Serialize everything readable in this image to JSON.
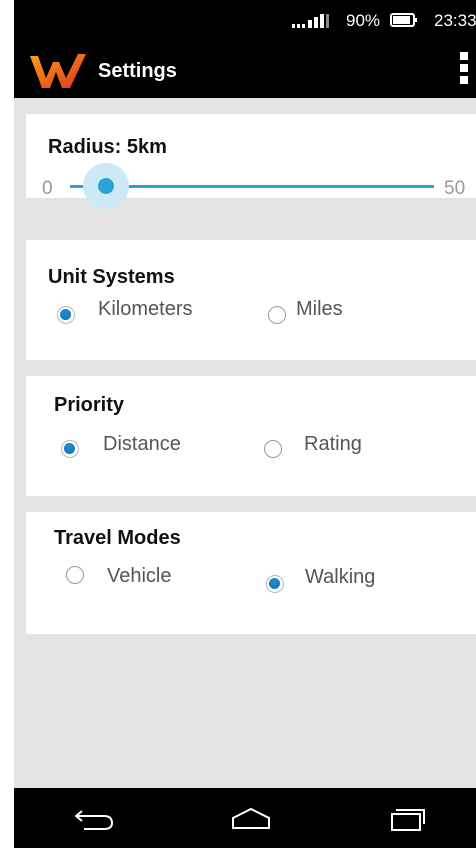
{
  "status_bar": {
    "battery_percent": "90%",
    "time": "23:33",
    "icons": [
      "signal-icon",
      "battery-icon"
    ]
  },
  "app_bar": {
    "title": "Settings",
    "icons": [
      "app-logo-icon",
      "overflow-menu-icon"
    ]
  },
  "radius": {
    "title": "Radius: 5km",
    "min_label": "0",
    "max_label": "50",
    "value": 5,
    "min": 0,
    "max": 50
  },
  "unit_systems": {
    "title": "Unit Systems",
    "options": [
      {
        "label": "Kilometers",
        "selected": true
      },
      {
        "label": "Miles",
        "selected": false
      }
    ]
  },
  "priority": {
    "title": "Priority",
    "options": [
      {
        "label": "Distance",
        "selected": true
      },
      {
        "label": "Rating",
        "selected": false
      }
    ]
  },
  "travel_modes": {
    "title": "Travel Modes",
    "options": [
      {
        "label": "Vehicle",
        "selected": false
      },
      {
        "label": "Walking",
        "selected": true
      }
    ]
  },
  "nav_bar": {
    "icons": [
      "back-icon",
      "home-icon",
      "recent-apps-icon"
    ]
  },
  "colors": {
    "accent": "#29a3d6",
    "radio_selected": "#1e88c8",
    "background": "#e3e3e3",
    "bar": "#000000"
  }
}
